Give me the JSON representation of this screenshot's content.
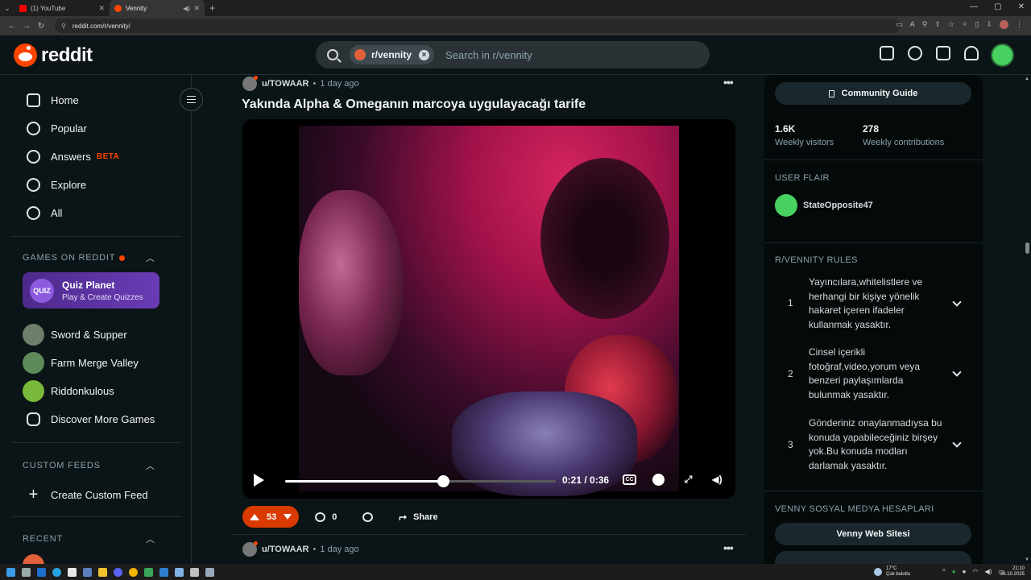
{
  "browser": {
    "tabs": [
      {
        "title": "(1) YouTube",
        "color": "#ff0000"
      },
      {
        "title": "Vennity",
        "color": "#ff4500"
      }
    ],
    "url": "reddit.com/r/vennity/"
  },
  "header": {
    "logo_text": "reddit",
    "search_chip": "r/vennity",
    "search_placeholder": "Search in r/vennity"
  },
  "sidebar": {
    "nav": [
      {
        "label": "Home",
        "icon": "home-icon"
      },
      {
        "label": "Popular",
        "icon": "popular-icon"
      },
      {
        "label": "Answers",
        "icon": "answers-icon",
        "badge": "BETA"
      },
      {
        "label": "Explore",
        "icon": "explore-icon"
      },
      {
        "label": "All",
        "icon": "all-icon"
      }
    ],
    "games_heading": "GAMES ON REDDIT",
    "quiz": {
      "logo": "QUIZ",
      "title": "Quiz Planet",
      "subtitle": "Play & Create Quizzes"
    },
    "games": [
      {
        "label": "Sword & Supper",
        "color": "#6d7f6a"
      },
      {
        "label": "Farm Merge Valley",
        "color": "#5f8a5a"
      },
      {
        "label": "Riddonkulous",
        "color": "#78b83a"
      },
      {
        "label": "Discover More Games",
        "color": ""
      }
    ],
    "custom_feeds_heading": "CUSTOM FEEDS",
    "create_custom_feed": "Create Custom Feed",
    "recent_heading": "RECENT"
  },
  "post": {
    "user": "u/TOWAAR",
    "time": "1 day ago",
    "title": "Yakında Alpha & Omeganın marcoya uygulayacağı tarife",
    "video": {
      "current": "0:21",
      "duration": "0:36",
      "progress": 0.583,
      "time_label": "0:21 / 0:36"
    },
    "votes": "53",
    "comments": "0",
    "share_label": "Share"
  },
  "next_post": {
    "user": "u/TOWAAR",
    "time": "1 day ago"
  },
  "community": {
    "guide_button": "Community Guide",
    "visitors_value": "1.6K",
    "visitors_label": "Weekly visitors",
    "contributions_value": "278",
    "contributions_label": "Weekly contributions",
    "user_flair_heading": "USER FLAIR",
    "flair_user": "StateOpposite47",
    "rules_heading": "R/VENNITY RULES",
    "rules": [
      {
        "num": "1",
        "text": "Yayıncılara,whitelistlere ve herhangi bir kişiye yönelik hakaret içeren ifadeler kullanmak yasaktır."
      },
      {
        "num": "2",
        "text": "Cinsel içerikli fotoğraf,video,yorum veya benzeri paylaşımlarda bulunmak yasaktır."
      },
      {
        "num": "3",
        "text": "Gönderiniz onaylanmadıysa bu konuda yapabileceğiniz birşey yok.Bu konuda modları darlamak yasaktır."
      }
    ],
    "social_heading": "VENNY SOSYAL MEDYA HESAPLARI",
    "social_links": [
      "Venny Web Sitesi"
    ]
  },
  "taskbar": {
    "weather_temp": "17°C",
    "weather_desc": "Çok bulutlu",
    "time": "21:10",
    "date": "26.10.2025"
  }
}
